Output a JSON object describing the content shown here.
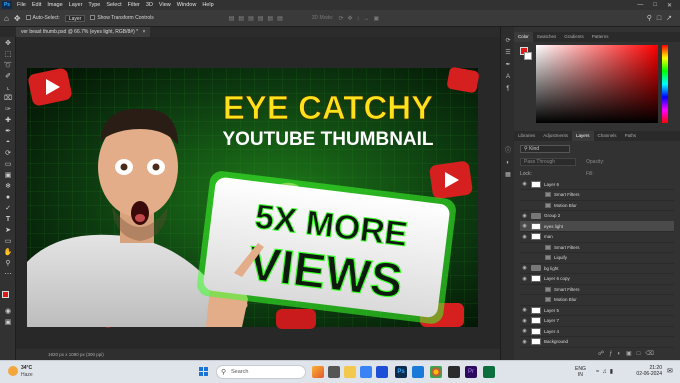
{
  "menubar": {
    "app": "Ps",
    "items": [
      "File",
      "Edit",
      "Image",
      "Layer",
      "Type",
      "Select",
      "Filter",
      "3D",
      "View",
      "Window",
      "Help"
    ]
  },
  "options": {
    "auto_select": "Auto-Select:",
    "auto_select_value": "Layer",
    "show_transform": "Show Transform Controls",
    "mode_3d": "3D Mode:"
  },
  "document_tab": "ver beast thumb.psd @ 66.7% (eyes light, RGB/8#) *",
  "status_bar": "1920 px x 1080 px (300 ppi)",
  "thumbnail": {
    "headline": "EYE CATCHY",
    "subtitle": "YOUTUBE THUMBNAIL",
    "sign_line1": "5X MORE",
    "sign_line2": "VIEWS"
  },
  "panels": {
    "color_tabs": [
      "Color",
      "Swatches",
      "Gradients",
      "Patterns"
    ],
    "mid_tabs": [
      "Libraries",
      "Adjustments",
      "Layers",
      "Channels",
      "Paths"
    ],
    "kind_filter": "Kind",
    "blend_mode": "Pass Through",
    "opacity_label": "Opacity:",
    "lock_label": "Lock:",
    "fill_label": "Fill:"
  },
  "layers": [
    {
      "name": "Layer 6",
      "type": "layer"
    },
    {
      "name": "Smart Filters",
      "type": "filter"
    },
    {
      "name": "Motion Blur",
      "type": "filter"
    },
    {
      "name": "Group 2",
      "type": "group"
    },
    {
      "name": "eyes light",
      "type": "layer"
    },
    {
      "name": "man",
      "type": "layer"
    },
    {
      "name": "Smart Filters",
      "type": "filter"
    },
    {
      "name": "Liquify",
      "type": "filter"
    },
    {
      "name": "bg light",
      "type": "group"
    },
    {
      "name": "Layer 6 copy",
      "type": "layer"
    },
    {
      "name": "Smart Filters",
      "type": "filter"
    },
    {
      "name": "Motion Blur",
      "type": "filter"
    },
    {
      "name": "Layer 5",
      "type": "layer"
    },
    {
      "name": "Layer 7",
      "type": "layer"
    },
    {
      "name": "Layer 4",
      "type": "layer"
    },
    {
      "name": "Background",
      "type": "layer"
    }
  ],
  "selected_layer_index": 4,
  "taskbar": {
    "weather_temp": "34°C",
    "weather_desc": "Haze",
    "search_placeholder": "Search",
    "lang1": "ENG",
    "lang2": "IN",
    "time": "21:20",
    "date": "02-06-2024"
  },
  "colors": {
    "accent_green": "#3dff2a",
    "headline_yellow": "#ffe21a",
    "selected_row": "#4a4a4a",
    "foreground_swatch": "#e01818"
  }
}
